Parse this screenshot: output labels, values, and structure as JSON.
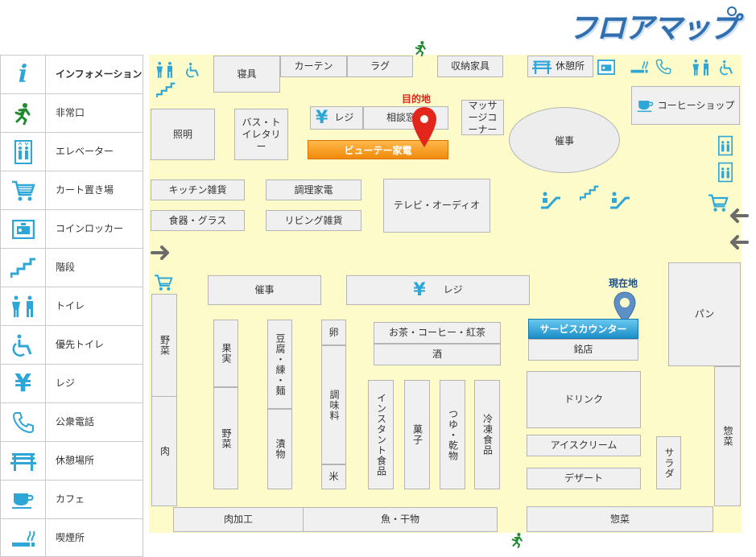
{
  "header": {
    "title": "フロアマップ"
  },
  "colors": {
    "icon_blue": "#2ea7d7",
    "exit_green": "#1f8a2e",
    "floor": "#fdfbc9",
    "destination_red": "#e3261b",
    "service_counter_blue": "#1c8fc8",
    "beauty_orange": "#f08a0c"
  },
  "legend": [
    {
      "icon": "information-icon",
      "label": "インフォメーション"
    },
    {
      "icon": "emergency-exit-icon",
      "label": "非常口"
    },
    {
      "icon": "elevator-icon",
      "label": "エレベーター"
    },
    {
      "icon": "cart-icon",
      "label": "カート置き場"
    },
    {
      "icon": "coin-locker-icon",
      "label": "コインロッカー"
    },
    {
      "icon": "stairs-icon",
      "label": "階段"
    },
    {
      "icon": "toilet-icon",
      "label": "トイレ"
    },
    {
      "icon": "priority-toilet-icon",
      "label": "優先トイレ"
    },
    {
      "icon": "yen-icon",
      "label": "レジ"
    },
    {
      "icon": "phone-icon",
      "label": "公衆電話"
    },
    {
      "icon": "bench-icon",
      "label": "休憩場所"
    },
    {
      "icon": "coffee-icon",
      "label": "カフェ"
    },
    {
      "icon": "smoking-icon",
      "label": "喫煙所"
    }
  ],
  "markers": {
    "destination": "目的地",
    "current": "現在地"
  },
  "stores": {
    "bedding": "寝具",
    "curtain": "カーテン",
    "rug": "ラグ",
    "storage": "収納家具",
    "rest": "休憩所",
    "coffee_shop": "コーヒーショップ",
    "lighting": "照明",
    "bath_toilet": "バス・トイレタリー",
    "register_top": "レジ",
    "consult": "相談窓口",
    "massage": "マッサージコーナー",
    "event_top": "催事",
    "beauty": "ビューテー家電",
    "kitchen": "キッチン雑貨",
    "cooking_appliances": "調理家電",
    "tableware": "食器・グラス",
    "living": "リビング雑貨",
    "tv_audio": "テレビ・オーディオ",
    "event_mid": "催事",
    "register_mid": "レジ",
    "bread": "パン",
    "vegetables_left": "野菜",
    "meat": "肉",
    "fruit": "果実",
    "vegetables": "野菜",
    "tofu": "豆腐・練・麺",
    "pickles": "漬物",
    "egg": "卵",
    "seasoning": "調味料",
    "rice": "米",
    "tea_coffee": "お茶・コーヒー・紅茶",
    "sake": "酒",
    "instant": "インスタント食品",
    "sweets": "菓子",
    "tsuyu": "つゆ・乾物",
    "frozen": "冷凍食品",
    "service_counter": "サービスカウンター",
    "local_store": "銘店",
    "drink": "ドリンク",
    "icecream": "アイスクリーム",
    "dessert": "デザート",
    "salad": "サラダ",
    "sozai_right": "惣菜",
    "processed_meat": "肉加工",
    "fish": "魚・干物",
    "sozai_bottom": "惣菜"
  }
}
